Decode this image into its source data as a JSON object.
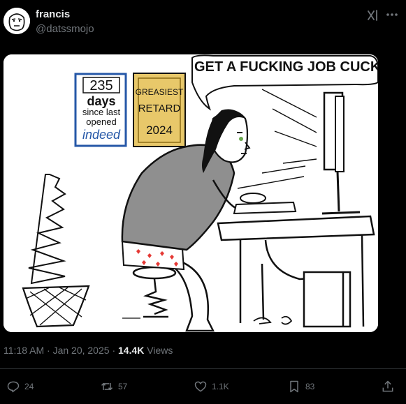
{
  "post": {
    "author_name": "francis",
    "author_handle": "@datssmojo",
    "time": "11:18 AM",
    "separator": "·",
    "date": "Jan 20, 2025",
    "views_count": "14.4K",
    "views_label": "Views"
  },
  "image": {
    "speech_text": "GET A FUCKING JOB CUCK",
    "sign_left": {
      "number": "235",
      "line1": "days",
      "line2": "since last",
      "line3": "opened",
      "brand": "indeed"
    },
    "sign_right": {
      "line1": "GREASIEST",
      "line2": "RETARD",
      "line3": "2024"
    }
  },
  "actions": {
    "replies": "24",
    "reposts": "57",
    "likes": "1.1K",
    "bookmarks": "83"
  },
  "icons": {
    "grok": "grok-icon",
    "more": "more-icon",
    "reply": "reply-icon",
    "repost": "repost-icon",
    "like": "like-icon",
    "bookmark": "bookmark-icon",
    "share": "share-icon"
  },
  "colors": {
    "background": "#000000",
    "text_primary": "#e7e9ea",
    "text_secondary": "#71767b",
    "divider": "#2f3336",
    "indeed_blue": "#2557a7",
    "plaque_gold": "#e8c86a"
  }
}
